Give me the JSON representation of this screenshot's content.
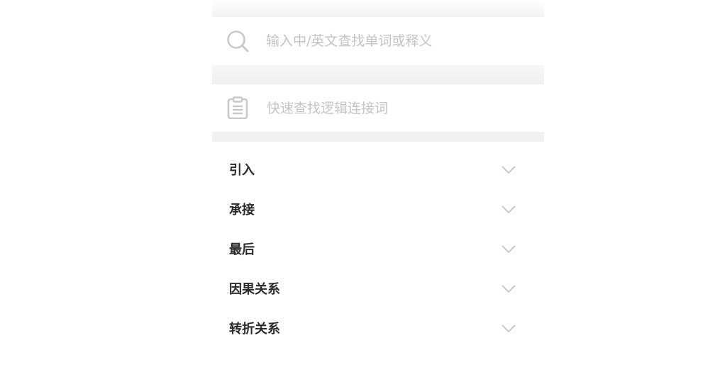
{
  "search": {
    "placeholder": "输入中/英文查找单词或释义",
    "icon": "search-icon"
  },
  "quick_find": {
    "label": "快速查找逻辑连接词",
    "icon": "clipboard-icon"
  },
  "categories": [
    {
      "label": "引入"
    },
    {
      "label": "承接"
    },
    {
      "label": "最后"
    },
    {
      "label": "因果关系"
    },
    {
      "label": "转折关系"
    }
  ],
  "colors": {
    "placeholder": "#c4c4c4",
    "label": "#2a2a2a",
    "icon": "#c8c8c8",
    "band": "#f0f0f0"
  }
}
